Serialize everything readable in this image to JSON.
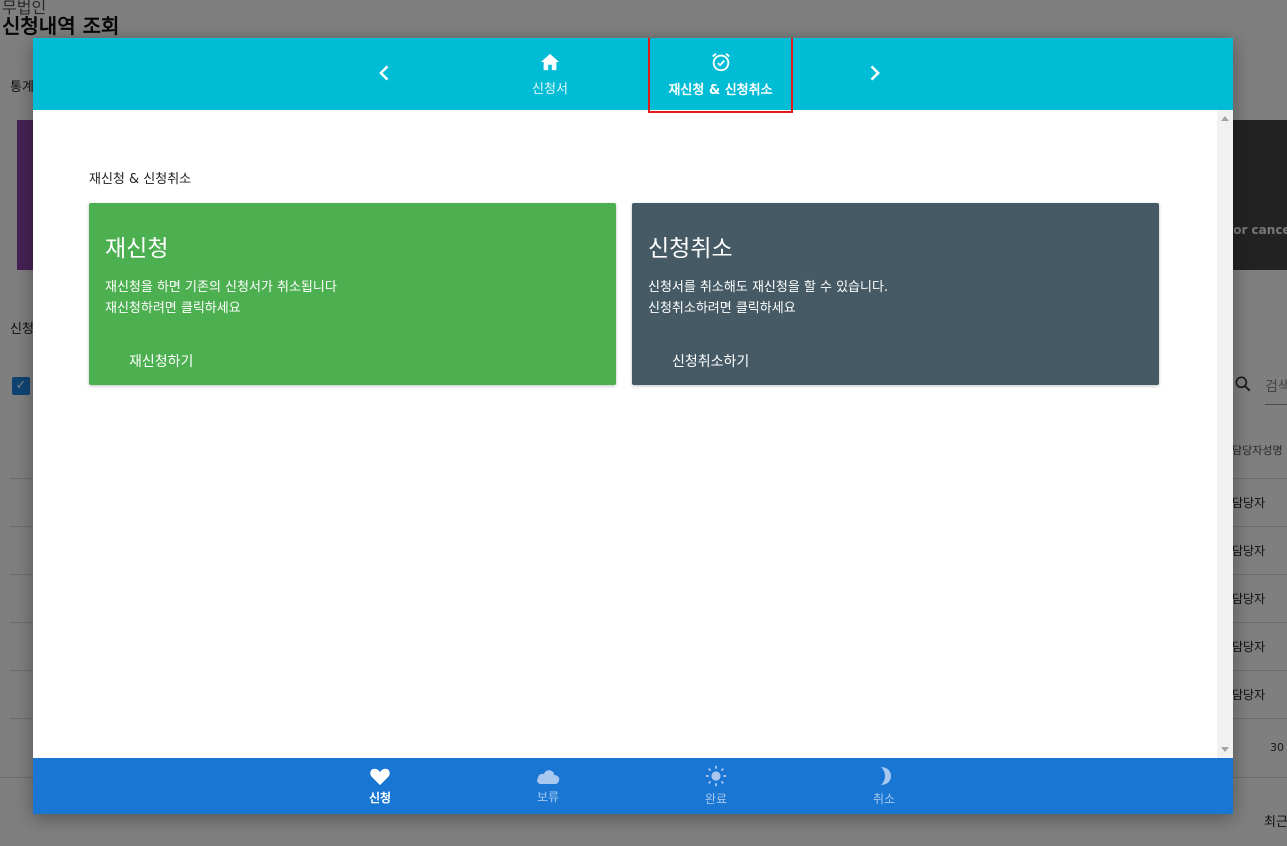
{
  "background": {
    "breadcrumb": "무법인",
    "page_title": "신청내역 조회",
    "stats_label": "통계",
    "dark_card_text": "for cance",
    "list_label": "신청",
    "search_placeholder": "검색",
    "column_header": "담당자성명",
    "row_values": [
      "담당자",
      "담당자",
      "담당자",
      "담당자",
      "담당자"
    ],
    "page_size": "30",
    "recent_label": "최근"
  },
  "modal": {
    "top_nav": {
      "tabs": [
        {
          "label": "신청서",
          "icon": "home-icon"
        },
        {
          "label": "재신청 & 신청취소",
          "icon": "alarm-check-icon"
        }
      ],
      "active_tab": "재신청 & 신청취소"
    },
    "section_title": "재신청 & 신청취소",
    "cards": {
      "reapply": {
        "title": "재신청",
        "desc_line1": "재신청을 하면 기존의 신청서가 취소됩니다",
        "desc_line2": "재신청하려면 클릭하세요",
        "button": "재신청하기",
        "color": "#4caf50"
      },
      "cancel": {
        "title": "신청취소",
        "desc_line1": "신청서를 취소해도 재신청을 할 수 있습니다.",
        "desc_line2": "신청취소하려면 클릭하세요",
        "button": "신청취소하기",
        "color": "#455a64"
      }
    },
    "bottom_nav": {
      "items": [
        {
          "label": "신청",
          "icon": "heart-icon"
        },
        {
          "label": "보류",
          "icon": "cloud-icon"
        },
        {
          "label": "완료",
          "icon": "sun-icon"
        },
        {
          "label": "취소",
          "icon": "moon-icon"
        }
      ],
      "active_item": "신청"
    }
  },
  "colors": {
    "top_bar": "#00bcd4",
    "bottom_bar": "#1976d2",
    "highlight": "#e01b1b"
  }
}
